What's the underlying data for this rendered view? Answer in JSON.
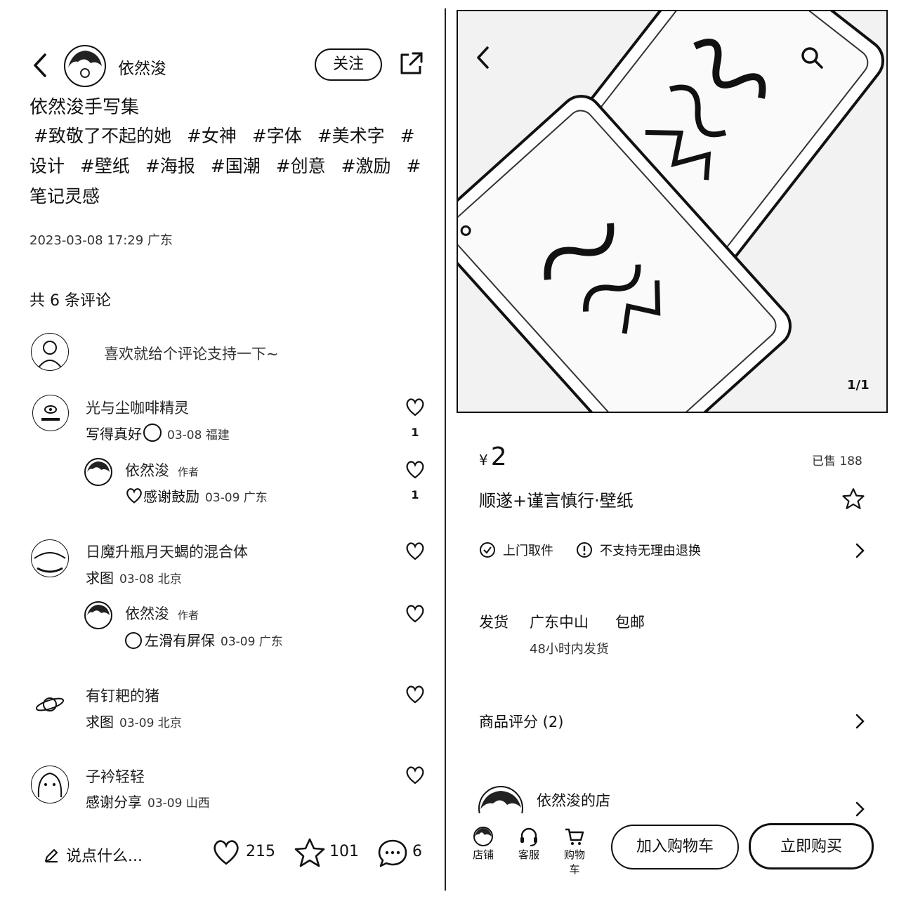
{
  "left": {
    "header": {
      "author": "依然浚",
      "follow_label": "关注"
    },
    "post": {
      "title": "依然浚手写集",
      "tags": [
        "#致敬了不起的她",
        "#女神",
        "#字体",
        "#美术字",
        "#设计",
        "#壁纸",
        "#海报",
        "#国潮",
        "#创意",
        "#激励",
        "#笔记灵感"
      ],
      "date": "2023-03-08 17:29 广东"
    },
    "comments_header": "共 6 条评论",
    "prompt": "喜欢就给个评论支持一下~",
    "comments": [
      {
        "name": "光与尘咖啡精灵",
        "text": "写得真好",
        "meta": "03-08 福建",
        "likes": "1",
        "reply": {
          "name": "依然浚",
          "author_tag": "作者",
          "text": "感谢鼓励",
          "meta": "03-09 广东",
          "likes": "1"
        }
      },
      {
        "name": "日魔升瓶月天蝎的混合体",
        "text": "求图",
        "meta": "03-08 北京",
        "reply": {
          "name": "依然浚",
          "author_tag": "作者",
          "text": "左滑有屏保",
          "meta": "03-09 广东"
        }
      },
      {
        "name": "有钉耙的猪",
        "text": "求图",
        "meta": "03-09 北京"
      },
      {
        "name": "子衿轻轻",
        "text": "感谢分享",
        "meta": "03-09 山西"
      }
    ],
    "bottom_bar": {
      "input_placeholder": "说点什么...",
      "likes": "215",
      "stars": "101",
      "comments": "6"
    }
  },
  "right": {
    "image_counter": "1/1",
    "price_symbol": "¥",
    "price": "2",
    "sold": "已售 188",
    "product_name": "顺遂+谨言慎行·壁纸",
    "services": [
      "上门取件",
      "不支持无理由退换"
    ],
    "shipping": {
      "label": "发货",
      "location": "广东中山",
      "free": "包邮",
      "time": "48小时内发货"
    },
    "reviews": "商品评分 (2)",
    "shop_name": "依然浚的店",
    "bottom_nav": [
      "店铺",
      "客服",
      "购物车"
    ],
    "add_cart": "加入购物车",
    "buy_now": "立即购买"
  }
}
